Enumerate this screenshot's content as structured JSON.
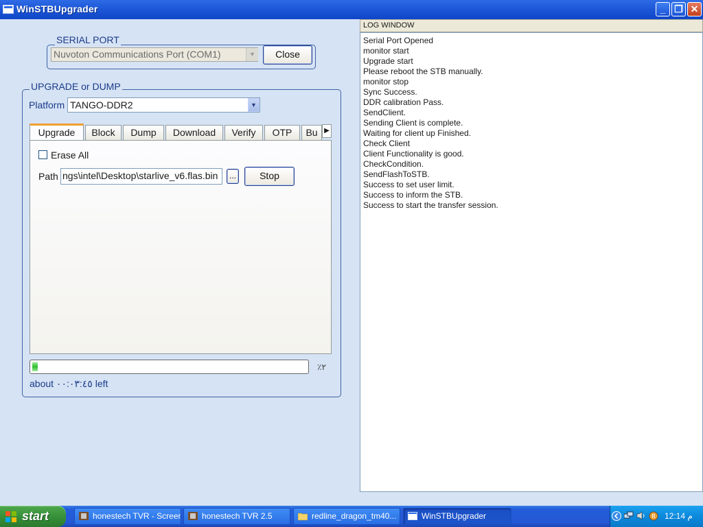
{
  "window": {
    "title": "WinSTBUpgrader",
    "min_glyph": "_",
    "max_glyph": "❐",
    "close_glyph": "✕"
  },
  "serial_port": {
    "legend": "SERIAL PORT",
    "selected_port": "Nuvoton Communications Port (COM1)",
    "close_label": "Close"
  },
  "upgrade": {
    "legend": "UPGRADE or DUMP",
    "platform_label": "Platform",
    "platform_value": "TANGO-DDR2",
    "tabs": [
      "Upgrade",
      "Block",
      "Dump",
      "Download",
      "Verify",
      "OTP",
      "Bu"
    ],
    "erase_all_label": "Erase All",
    "erase_all_checked": false,
    "path_label": "Path",
    "path_value": "ngs\\intel\\Desktop\\starlive_v6.flas.bin",
    "browse_label": "...",
    "stop_label": "Stop",
    "progress_percent_text": "٪٢",
    "progress_fraction": 0.02,
    "time_left": "about ۰۰:۰۳:٤٥ left"
  },
  "log": {
    "header": "LOG WINDOW",
    "lines": [
      "Serial Port Opened",
      "monitor start",
      "Upgrade start",
      "Please reboot the STB manually.",
      "monitor stop",
      "Sync Success.",
      "DDR calibration Pass.",
      "SendClient.",
      "Sending Client is complete.",
      "Waiting for client up Finished.",
      "Check Client",
      "Client Functionality is good.",
      "CheckCondition.",
      "SendFlashToSTB.",
      "Success to set user limit.",
      "Success to inform the STB.",
      "Success to start the transfer session."
    ]
  },
  "taskbar": {
    "start_label": "start",
    "tasks": [
      {
        "label": "honestech TVR - Screen",
        "icon": "film-icon",
        "active": false
      },
      {
        "label": "honestech TVR 2.5",
        "icon": "film-icon",
        "active": false
      },
      {
        "label": "redline_dragon_tm40...",
        "icon": "folder-icon",
        "active": false
      },
      {
        "label": "WinSTBUpgrader",
        "icon": "window-icon",
        "active": true
      }
    ],
    "clock": "12:14 م"
  }
}
